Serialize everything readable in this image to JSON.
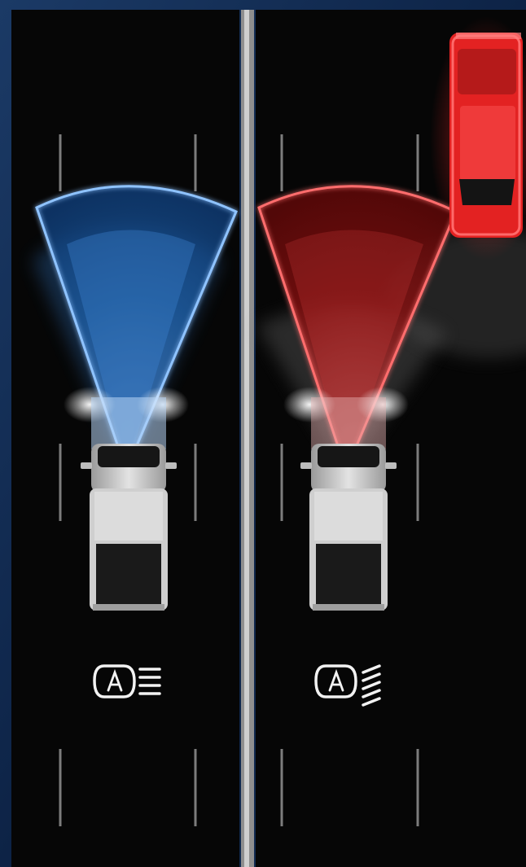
{
  "panels": [
    {
      "id": "high-beam",
      "beam_color": "#3f8fe0",
      "beam_glow": "#9cc7ff",
      "indicator_icon": "auto-high-beam-icon"
    },
    {
      "id": "low-beam",
      "beam_color": "#ff3b3b",
      "beam_glow": "#ff8a8a",
      "indicator_icon": "auto-low-beam-icon"
    }
  ],
  "oncoming_vehicle": {
    "color": "#e32222"
  },
  "colors": {
    "road": "#060606",
    "lane_marking": "#8a8a8a",
    "divider": "#bdbdbd",
    "truck_body": "#c8c8c8",
    "background": "#0b1a33"
  }
}
